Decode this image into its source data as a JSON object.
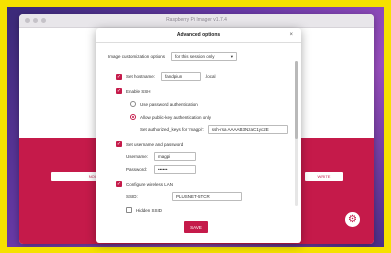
{
  "window": {
    "title": "Raspberry Pi Imager v1.7.4"
  },
  "main": {
    "left_button": "NOOBS",
    "right_button": "WRITE"
  },
  "dialog": {
    "title": "Advanced options",
    "close": "×",
    "customization_label": "Image customization options",
    "customization_value": "for this session only",
    "hostname": {
      "label": "Set hostname:",
      "value": "fandpiun",
      "suffix": ".local",
      "checked": true
    },
    "ssh": {
      "label": "Enable SSH",
      "checked": true,
      "option_password": "Use password authentication",
      "option_pubkey": "Allow public-key authentication only",
      "authorized_keys_label": "Set authorized_keys for 'magpi':",
      "authorized_keys_value": "ssh-rsa AAAAB3NzaC1yc2E"
    },
    "user": {
      "label": "Set username and password",
      "checked": true,
      "username_label": "Username:",
      "username_value": "magpi",
      "password_label": "Password:",
      "password_value": "••••••"
    },
    "wifi": {
      "label": "Configure wireless LAN",
      "checked": true,
      "ssid_label": "SSID:",
      "ssid_value": "PLUSNET-5TCR",
      "hidden_label": "Hidden SSID"
    },
    "save": "SAVE"
  },
  "icons": {
    "check": "✓",
    "dropdown": "▾",
    "gear": "⚙"
  },
  "colors": {
    "brand": "#c51a4a",
    "frame": "#f5e100"
  }
}
